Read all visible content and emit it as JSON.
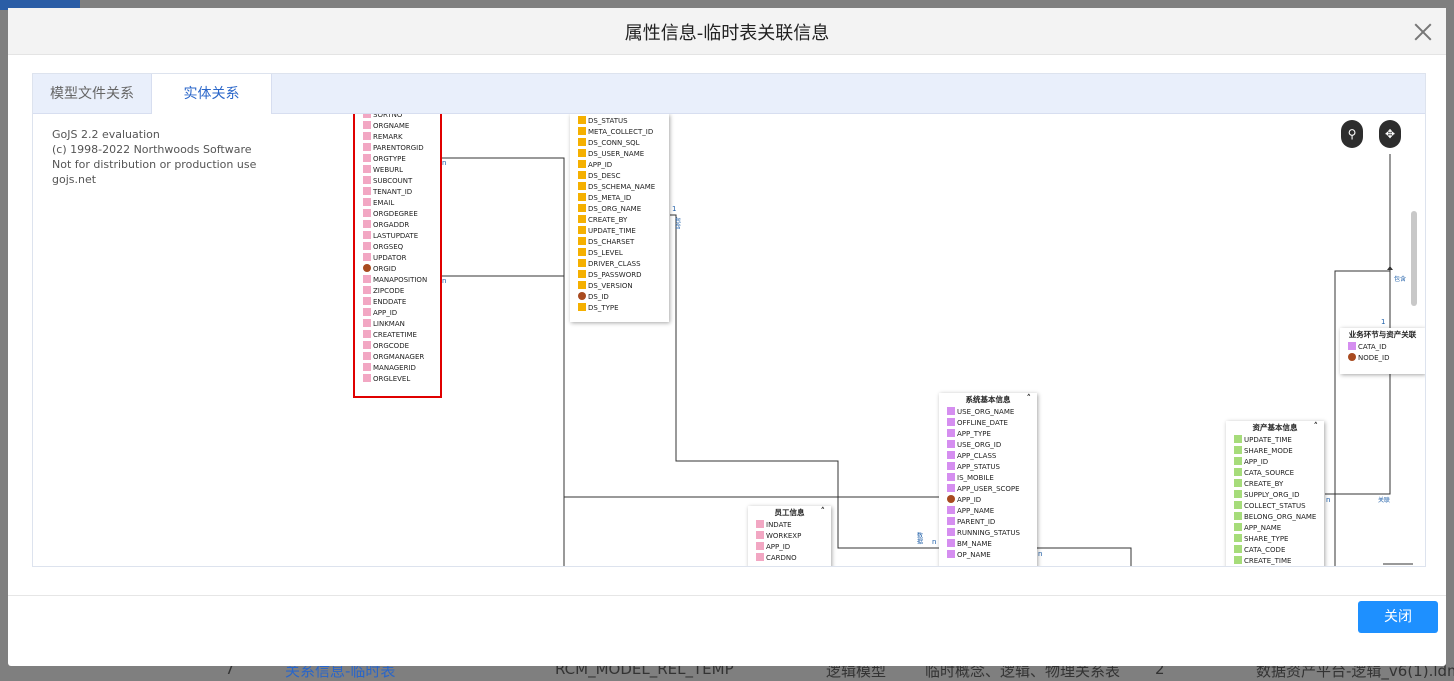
{
  "background": {
    "row": [
      "7",
      "关系信息-临时表",
      "RCM_MODEL_REL_TEMP",
      "逻辑模型",
      "临时概念、逻辑、物理关系表",
      "2",
      "数据资产平台-逻辑_v6(1).ldm"
    ]
  },
  "modal": {
    "title": "属性信息-临时表关联信息",
    "tabs": [
      {
        "label": "模型文件关系",
        "active": false
      },
      {
        "label": "实体关系",
        "active": true
      }
    ],
    "close_label": "关闭"
  },
  "gojs_notice": [
    "GoJS 2.2 evaluation",
    "(c) 1998-2022 Northwoods Software",
    "Not for distribution or production use",
    "gojs.net"
  ],
  "colors": {
    "pink": "#f2a7c3",
    "orange": "#f5b000",
    "purple": "#d58ef0",
    "green": "#a6dc7a",
    "key": "#a84a1f",
    "selected_border": "#e00000",
    "accent": "#1e90ff"
  },
  "diagram": {
    "nodes": {
      "org": {
        "title": "",
        "swatch": "#f2a7c3",
        "fields": [
          "SORTNO",
          "ORGNAME",
          "REMARK",
          "PARENTORGID",
          "ORGTYPE",
          "WEBURL",
          "SUBCOUNT",
          "TENANT_ID",
          "EMAIL",
          "ORGDEGREE",
          "ORGADDR",
          "LASTUPDATE",
          "ORGSEQ",
          "UPDATOR",
          "ORGID",
          "MANAPOSITION",
          "ZIPCODE",
          "ENDDATE",
          "APP_ID",
          "LINKMAN",
          "CREATETIME",
          "ORGCODE",
          "ORGMANAGER",
          "MANAGERID",
          "ORGLEVEL"
        ],
        "key": "ORGID"
      },
      "ds": {
        "title": "",
        "swatch": "#f5b000",
        "fields": [
          "DS_STATUS",
          "META_COLLECT_ID",
          "DS_CONN_SQL",
          "DS_USER_NAME",
          "APP_ID",
          "DS_DESC",
          "DS_SCHEMA_NAME",
          "DS_META_ID",
          "DS_ORG_NAME",
          "CREATE_BY",
          "UPDATE_TIME",
          "DS_CHARSET",
          "DS_LEVEL",
          "DRIVER_CLASS",
          "DS_PASSWORD",
          "DS_VERSION",
          "DS_ID",
          "DS_TYPE"
        ],
        "key": "DS_ID"
      },
      "sys": {
        "title": "系统基本信息",
        "swatch": "#d58ef0",
        "fields": [
          "USE_ORG_NAME",
          "OFFLINE_DATE",
          "APP_TYPE",
          "USE_ORG_ID",
          "APP_CLASS",
          "APP_STATUS",
          "IS_MOBILE",
          "APP_USER_SCOPE",
          "APP_ID",
          "APP_NAME",
          "PARENT_ID",
          "RUNNING_STATUS",
          "BM_NAME",
          "OP_NAME"
        ],
        "key": "APP_ID"
      },
      "emp": {
        "title": "员工信息",
        "swatch": "#f2a7c3",
        "fields": [
          "INDATE",
          "WORKEXP",
          "APP_ID",
          "CARDNO"
        ],
        "key": ""
      },
      "asset": {
        "title": "资产基本信息",
        "swatch": "#a6dc7a",
        "fields": [
          "UPDATE_TIME",
          "SHARE_MODE",
          "APP_ID",
          "CATA_SOURCE",
          "CREATE_BY",
          "SUPPLY_ORG_ID",
          "COLLECT_STATUS",
          "BELONG_ORG_NAME",
          "APP_NAME",
          "SHARE_TYPE",
          "CATA_CODE",
          "CREATE_TIME"
        ],
        "key": ""
      },
      "biz": {
        "title": "业务环节与资产关联",
        "swatch": "#d58ef0",
        "fields": [
          "CATA_ID",
          "NODE_ID"
        ],
        "key": "NODE_ID"
      }
    },
    "link_labels": {
      "n1": "n",
      "n2": "n",
      "one1": "1",
      "contains1": "包含",
      "contains2": "包含",
      "one2": "1",
      "n3": "n",
      "data": "数据",
      "n4": "n",
      "relate": "关联",
      "n5": "n"
    },
    "search_icon": "search-icon",
    "move_icon": "move-icon"
  }
}
